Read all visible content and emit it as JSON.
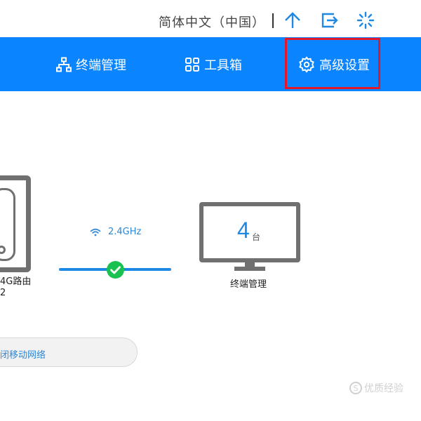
{
  "header": {
    "language": "简体中文（中国）",
    "icons": [
      "upload-icon",
      "logout-icon",
      "loading-icon"
    ]
  },
  "nav": {
    "items": [
      {
        "label": "终端管理",
        "icon": "network-topology-icon"
      },
      {
        "label": "工具箱",
        "icon": "grid-tiles-icon"
      },
      {
        "label": "高级设置",
        "icon": "gear-icon"
      }
    ],
    "highlighted": "高级设置"
  },
  "router": {
    "label_line1": "4G路由",
    "label_line2": "2"
  },
  "link": {
    "band": "2.4GHz",
    "status_icon": "check-icon"
  },
  "devices": {
    "count": "4",
    "unit": "台",
    "label": "终端管理"
  },
  "mobile_network": {
    "label": "闭移动网络"
  },
  "watermark": {
    "logo_text": "S",
    "text": "优质经验"
  },
  "colors": {
    "nav_bg": "#0a84ff",
    "accent_blue": "#1e88e5",
    "highlight_red": "#e3192b",
    "status_green": "#19c250",
    "device_gray": "#707070"
  }
}
